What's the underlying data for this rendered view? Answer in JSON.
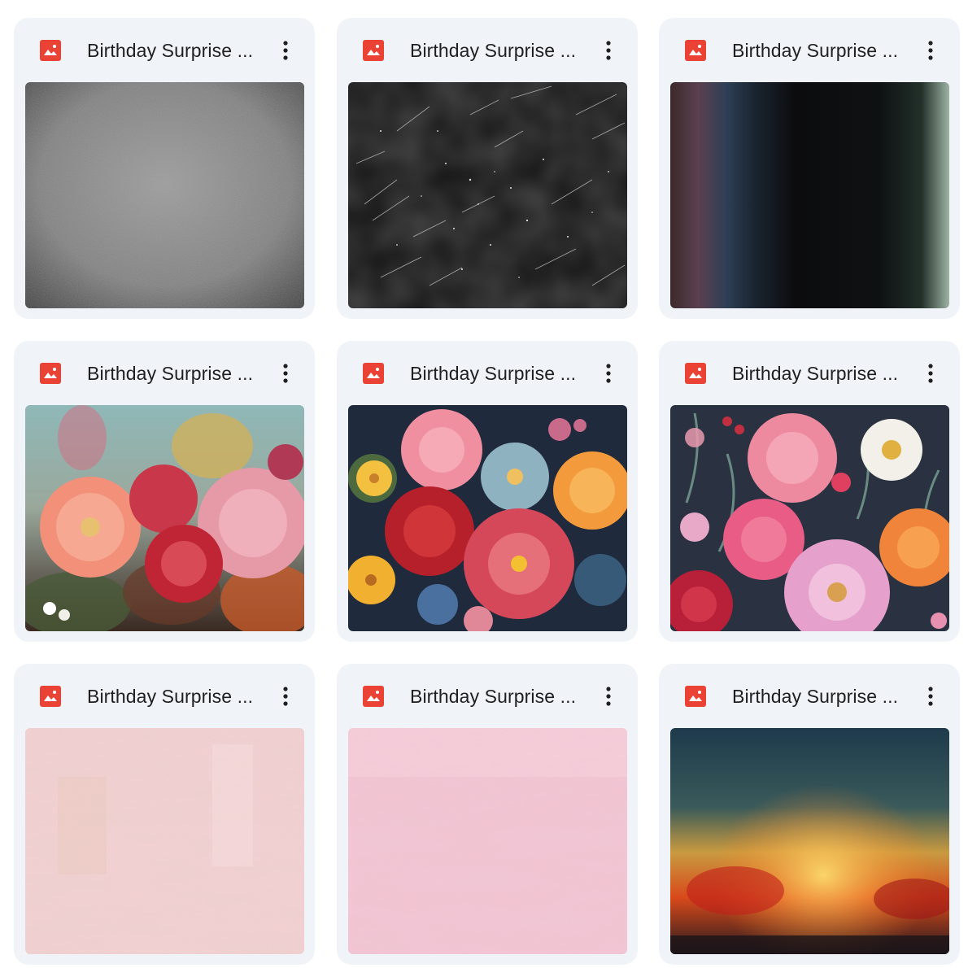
{
  "files": [
    {
      "name": "Birthday Surprise ...",
      "icon": "image-file-icon",
      "thumbnail": "gray-noise-texture"
    },
    {
      "name": "Birthday Surprise ...",
      "icon": "image-file-icon",
      "thumbnail": "black-scratched-texture"
    },
    {
      "name": "Birthday Surprise ...",
      "icon": "image-file-icon",
      "thumbnail": "dark-light-leak-texture"
    },
    {
      "name": "Birthday Surprise ...",
      "icon": "image-file-icon",
      "thumbnail": "painted-peony-bouquet"
    },
    {
      "name": "Birthday Surprise ...",
      "icon": "image-file-icon",
      "thumbnail": "colorful-3d-flowers"
    },
    {
      "name": "Birthday Surprise ...",
      "icon": "image-file-icon",
      "thumbnail": "pink-orange-floral-dark"
    },
    {
      "name": "Birthday Surprise ...",
      "icon": "image-file-icon",
      "thumbnail": "pale-pink-grunge-texture"
    },
    {
      "name": "Birthday Surprise ...",
      "icon": "image-file-icon",
      "thumbnail": "pink-plaster-texture"
    },
    {
      "name": "Birthday Surprise ...",
      "icon": "image-file-icon",
      "thumbnail": "fire-glow-abstract"
    }
  ],
  "colors": {
    "card_background": "#f0f4f9",
    "image_icon": "#ea4335",
    "text": "#1f1f1f"
  },
  "more_icon": "more-vert-icon"
}
